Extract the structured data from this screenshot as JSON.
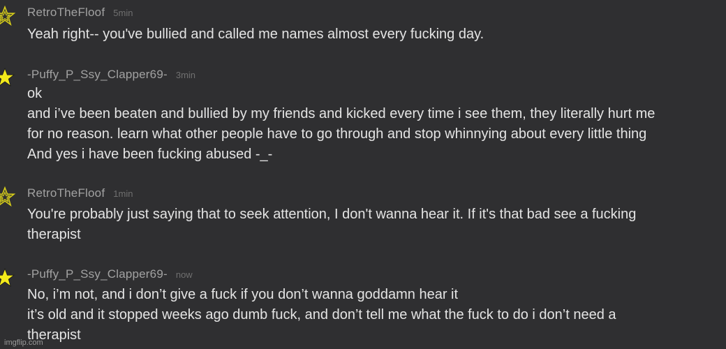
{
  "colors": {
    "background": "#2f2f31",
    "username": "#a2a2a2",
    "timestamp": "#707070",
    "message": "#e4e4e4",
    "star_filled": "#f3ea1b",
    "star_outline": "#d8cf1a"
  },
  "comments": [
    {
      "username": "RetroTheFloof",
      "time": "5min",
      "star_icon": "star-outline-icon",
      "lines": [
        "Yeah right-- you've bullied and called me names almost every fucking day."
      ]
    },
    {
      "username": "-Puffy_P_Ssy_Clapper69-",
      "time": "3min",
      "star_icon": "star-filled-icon",
      "lines": [
        "ok",
        "and i’ve been beaten and bullied by my friends and kicked every time i see them, they literally hurt me",
        "for no reason. learn what other people have to go through and stop whinnying about every little thing",
        "And yes i have been fucking abused -_-"
      ]
    },
    {
      "username": "RetroTheFloof",
      "time": "1min",
      "star_icon": "star-outline-icon",
      "lines": [
        "You're probably just saying that to seek attention, I don't wanna hear it. If it's that bad see a fucking",
        "therapist"
      ]
    },
    {
      "username": "-Puffy_P_Ssy_Clapper69-",
      "time": "now",
      "star_icon": "star-filled-icon",
      "lines": [
        "No, i’m not, and i don’t give a fuck if you don’t wanna goddamn hear it",
        "it’s old and it stopped weeks ago dumb fuck, and don’t tell me what the fuck to do i don’t need a",
        "therapist"
      ]
    }
  ],
  "watermark": "imgflip.com"
}
